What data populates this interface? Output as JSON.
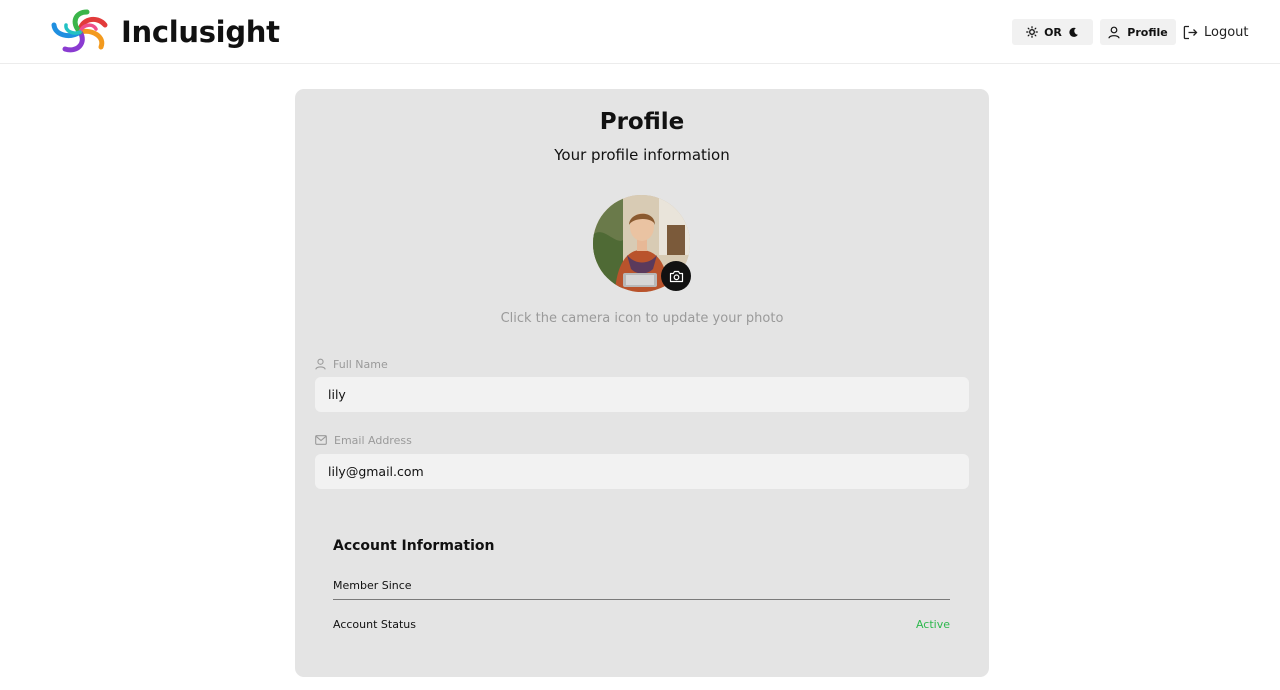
{
  "brand": {
    "name": "Inclusight",
    "logo_icon": "swirl-logo-icon"
  },
  "header": {
    "theme_toggle_label": "OR",
    "profile_label": "Profile",
    "logout_label": "Logout"
  },
  "profile": {
    "title": "Profile",
    "subtitle": "Your profile information",
    "photo_hint": "Click the camera icon to update your photo",
    "fields": {
      "full_name": {
        "label": "Full Name",
        "value": "lily"
      },
      "email": {
        "label": "Email Address",
        "value": "lily@gmail.com"
      }
    }
  },
  "account": {
    "title": "Account Information",
    "member_since_label": "Member Since",
    "member_since_value": "",
    "status_label": "Account Status",
    "status_value": "Active",
    "status_color": "#2db84d"
  },
  "colors": {
    "card_bg": "#e4e4e4",
    "input_bg": "#f2f2f2",
    "accent_dark": "#111111"
  }
}
